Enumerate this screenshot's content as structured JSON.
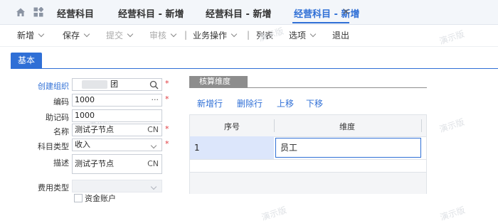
{
  "tabs": [
    {
      "label": "经营科目"
    },
    {
      "label": "经营科目 - 新增"
    },
    {
      "label": "经营科目 - 新增"
    },
    {
      "label": "经营科目 - 新增",
      "active": true
    }
  ],
  "close_glyph": "✕",
  "toolbar": {
    "new": "新增",
    "save": "保存",
    "submit": "提交",
    "audit": "审核",
    "separator": "|",
    "business_ops": "业务操作",
    "list": "列表",
    "options": "选项",
    "exit": "退出"
  },
  "watermark": "演示版",
  "section_tab": "基本",
  "form": {
    "org_label": "创建组织",
    "org_value": "团",
    "code_label": "编码",
    "code_value": "1000",
    "code_suffix": "···",
    "mnemonic_label": "助记码",
    "mnemonic_value": "1000",
    "name_label": "名称",
    "name_value": "测试子节点",
    "name_suffix": "CN",
    "type_label": "科目类型",
    "type_value": "收入",
    "desc_label": "描述",
    "desc_value": "测试子节点",
    "desc_suffix": "CN",
    "expense_label": "费用类型",
    "expense_value": "",
    "fund_account_label": "资金账户",
    "fund_account_checked": false,
    "required_mark": "*"
  },
  "dimension_panel": {
    "tab_label": "核算维度",
    "buttons": {
      "add_row": "新增行",
      "delete_row": "删除行",
      "move_up": "上移",
      "move_down": "下移"
    },
    "columns": [
      "序号",
      "维度"
    ],
    "rows": [
      {
        "index": "1",
        "dimension": "员工"
      }
    ]
  },
  "colors": {
    "accent": "#2f6fd6",
    "required": "#e0393e",
    "selected_row": "#dce6fb"
  }
}
